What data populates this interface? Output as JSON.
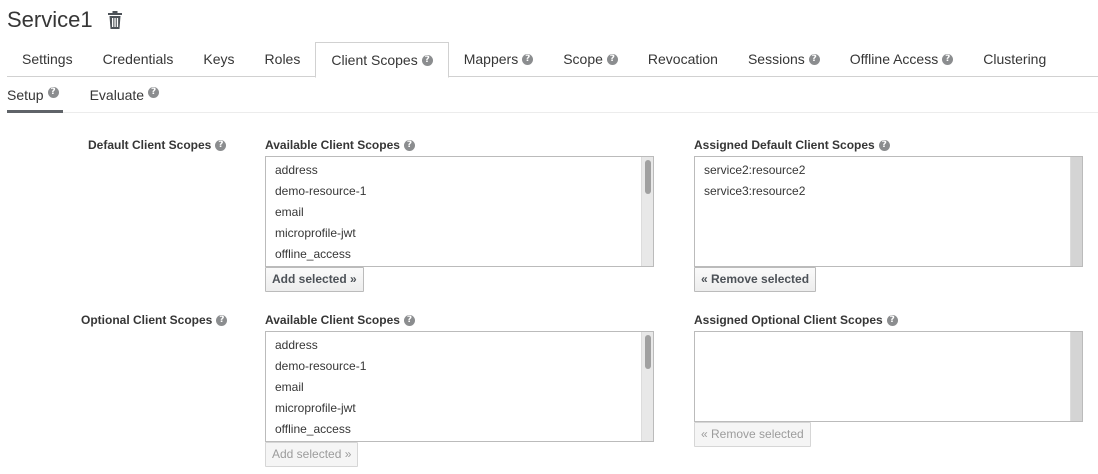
{
  "header": {
    "title": "Service1",
    "delete_icon": "trash-icon"
  },
  "tabs": [
    {
      "label": "Settings",
      "help": false
    },
    {
      "label": "Credentials",
      "help": false
    },
    {
      "label": "Keys",
      "help": false
    },
    {
      "label": "Roles",
      "help": false
    },
    {
      "label": "Client Scopes",
      "help": true,
      "active": true
    },
    {
      "label": "Mappers",
      "help": true
    },
    {
      "label": "Scope",
      "help": true
    },
    {
      "label": "Revocation",
      "help": false
    },
    {
      "label": "Sessions",
      "help": true
    },
    {
      "label": "Offline Access",
      "help": true
    },
    {
      "label": "Clustering",
      "help": false
    }
  ],
  "subtabs": [
    {
      "label": "Setup",
      "active": true
    },
    {
      "label": "Evaluate",
      "active": false
    }
  ],
  "default_scopes": {
    "row_label": "Default Client Scopes",
    "available_label": "Available Client Scopes",
    "available_items": [
      "address",
      "demo-resource-1",
      "email",
      "microprofile-jwt",
      "offline_access"
    ],
    "add_button": "Add selected »",
    "assigned_label": "Assigned Default Client Scopes",
    "assigned_items": [
      "service2:resource2",
      "service3:resource2"
    ],
    "remove_button": "« Remove selected"
  },
  "optional_scopes": {
    "row_label": "Optional Client Scopes",
    "available_label": "Available Client Scopes",
    "available_items": [
      "address",
      "demo-resource-1",
      "email",
      "microprofile-jwt",
      "offline_access"
    ],
    "add_button": "Add selected »",
    "assigned_label": "Assigned Optional Client Scopes",
    "assigned_items": [],
    "remove_button": "« Remove selected"
  },
  "help_glyph": "?"
}
